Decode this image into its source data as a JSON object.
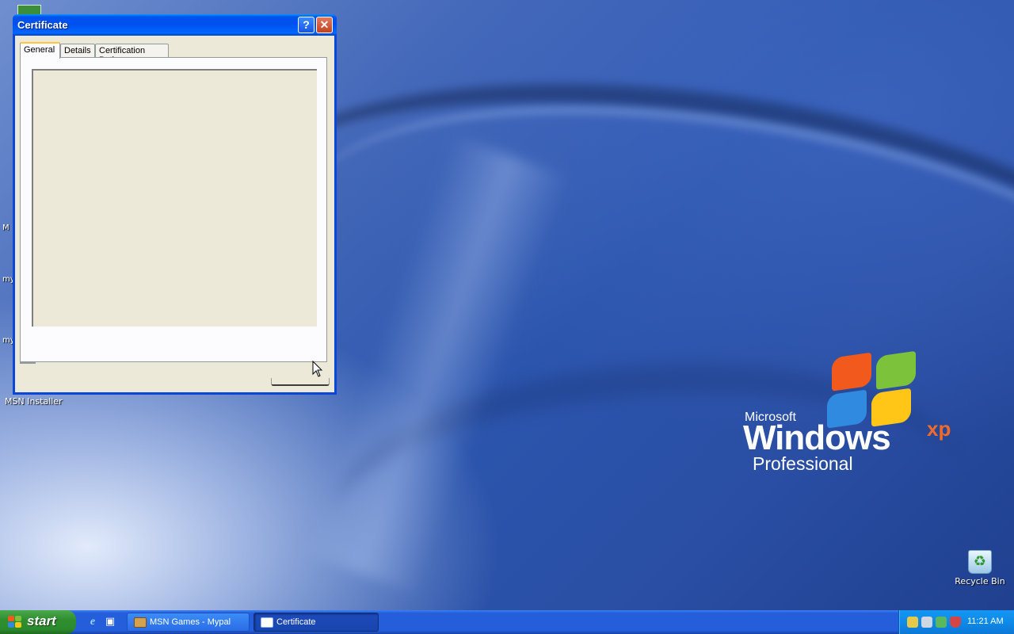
{
  "desktop": {
    "icons": [
      {
        "label": "MSN Installer"
      },
      {
        "label": "Recycle Bin"
      }
    ],
    "clipped_labels": [
      "M",
      "my",
      "my"
    ],
    "logo": {
      "brand": "Microsoft",
      "product": "Windows",
      "suffix": "xp",
      "edition": "Professional",
      "tm": "®"
    }
  },
  "window": {
    "title": "Certificate",
    "help_glyph": "?",
    "close_glyph": "✕",
    "tabs": [
      {
        "label": "General",
        "active": true
      },
      {
        "label": "Details",
        "active": false
      },
      {
        "label": "Certification Path",
        "active": false
      }
    ]
  },
  "taskbar": {
    "start_label": "start",
    "tasks": [
      {
        "label": "MSN Games - Mypal",
        "active": false
      },
      {
        "label": "Certificate",
        "active": true
      }
    ],
    "clock": "11:21 AM"
  },
  "colors": {
    "titlebar": "#0053ee",
    "taskbar": "#245edb",
    "start_button": "#2f8f2f",
    "dialog_face": "#ece9d8",
    "tray": "#0f8ae8"
  }
}
